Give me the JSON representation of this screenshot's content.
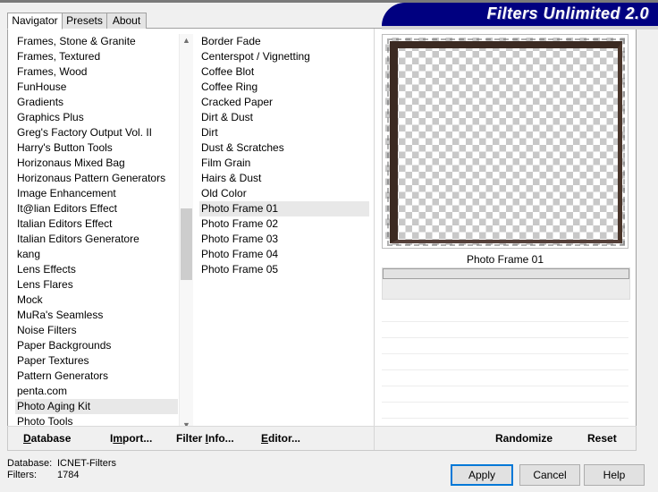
{
  "window": {
    "banner_title": "Filters Unlimited 2.0"
  },
  "tabs": [
    {
      "label": "Navigator",
      "active": true
    },
    {
      "label": "Presets",
      "active": false
    },
    {
      "label": "About",
      "active": false
    }
  ],
  "category_list": {
    "selected": "Photo Aging Kit",
    "items": [
      "Frames, Stone & Granite",
      "Frames, Textured",
      "Frames, Wood",
      "FunHouse",
      "Gradients",
      "Graphics Plus",
      "Greg's Factory Output Vol. II",
      "Harry's Button Tools",
      "Horizonaus Mixed Bag",
      "Horizonaus Pattern Generators",
      "Image Enhancement",
      "It@lian Editors Effect",
      "Italian Editors Effect",
      "Italian Editors Generatore",
      "kang",
      "Lens Effects",
      "Lens Flares",
      "Mock",
      "MuRa's Seamless",
      "Noise Filters",
      "Paper Backgrounds",
      "Paper Textures",
      "Pattern Generators",
      "penta.com",
      "Photo Aging Kit",
      "Photo Tools"
    ]
  },
  "filter_list": {
    "selected": "Photo Frame 01",
    "items": [
      "Border Fade",
      "Centerspot / Vignetting",
      "Coffee Blot",
      "Coffee Ring",
      "Cracked Paper",
      "Dirt & Dust",
      "Dirt",
      "Dust & Scratches",
      "Film Grain",
      "Hairs & Dust",
      "Old Color",
      "Photo Frame 01",
      "Photo Frame 02",
      "Photo Frame 03",
      "Photo Frame 04",
      "Photo Frame 05"
    ]
  },
  "preview": {
    "caption": "Photo Frame 01",
    "frame_color": "#3b2a22",
    "checker_color": "#c8c8c8"
  },
  "toolbar": {
    "left": [
      {
        "label": "Database",
        "mnemonic": "D"
      },
      {
        "label": "Import...",
        "mnemonic": "m"
      },
      {
        "label": "Filter Info...",
        "mnemonic": "I"
      },
      {
        "label": "Editor...",
        "mnemonic": "E"
      }
    ],
    "right": [
      {
        "label": "Randomize"
      },
      {
        "label": "Reset"
      }
    ]
  },
  "status": {
    "database_label": "Database:",
    "database_value": "ICNET-Filters",
    "filters_label": "Filters:",
    "filters_value": "1784"
  },
  "dialog_buttons": [
    {
      "label": "Apply",
      "primary": true
    },
    {
      "label": "Cancel",
      "primary": false
    },
    {
      "label": "Help",
      "primary": false
    }
  ],
  "colors": {
    "banner_bg": "#000080",
    "focus_border": "#0078d7",
    "selection_bg": "#e8e8e8"
  }
}
